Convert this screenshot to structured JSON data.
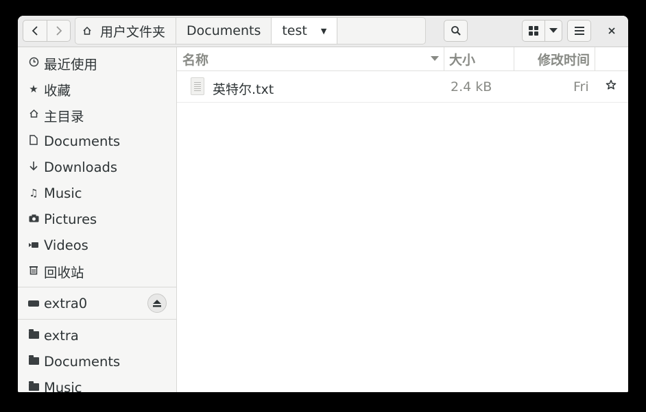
{
  "header": {
    "breadcrumbs": [
      "用户文件夹",
      "Documents",
      "test"
    ],
    "current_caret": "▼",
    "icons": {
      "back": "chevron-left-icon",
      "forward": "chevron-right-icon",
      "home": "home-icon",
      "search": "search-icon",
      "grid": "grid-view-icon",
      "view_dropdown": "chevron-down-icon",
      "menu": "hamburger-menu-icon",
      "close": "close-icon"
    }
  },
  "sidebar": {
    "places": [
      {
        "label": "最近使用",
        "icon": "clock-icon"
      },
      {
        "label": "收藏",
        "icon": "star-icon"
      },
      {
        "label": "主目录",
        "icon": "home-icon"
      },
      {
        "label": "Documents",
        "icon": "document-icon"
      },
      {
        "label": "Downloads",
        "icon": "download-icon"
      },
      {
        "label": "Music",
        "icon": "music-icon"
      },
      {
        "label": "Pictures",
        "icon": "camera-icon"
      },
      {
        "label": "Videos",
        "icon": "video-icon"
      },
      {
        "label": "回收站",
        "icon": "trash-icon"
      }
    ],
    "devices": [
      {
        "label": "extra0",
        "icon": "drive-icon",
        "eject": "eject-icon"
      }
    ],
    "bookmarks": [
      {
        "label": "extra",
        "icon": "folder-icon"
      },
      {
        "label": "Documents",
        "icon": "folder-icon"
      },
      {
        "label": "Music",
        "icon": "folder-icon"
      }
    ]
  },
  "columns": {
    "name": "名称",
    "size": "大小",
    "modified": "修改时间"
  },
  "files": [
    {
      "name": "英特尔.txt",
      "size": "2.4 kB",
      "modified": "Fri",
      "icon": "text-file-icon",
      "starred_icon": "star-outline-icon"
    }
  ],
  "colors": {
    "header_bg": "#ebebeb",
    "sidebar_bg": "#f6f6f5",
    "text": "#2e3436",
    "muted": "#888a85"
  }
}
